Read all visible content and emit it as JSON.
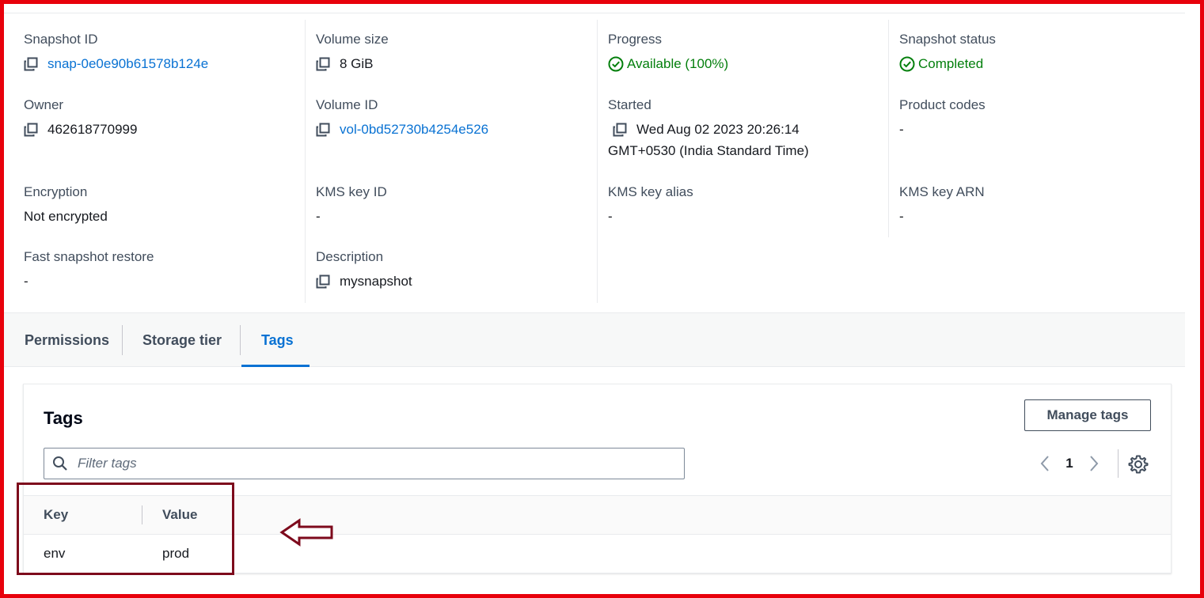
{
  "details": {
    "snapshot_id": {
      "label": "Snapshot ID",
      "value": "snap-0e0e90b61578b124e"
    },
    "volume_size": {
      "label": "Volume size",
      "value": "8 GiB"
    },
    "progress": {
      "label": "Progress",
      "value": "Available (100%)"
    },
    "snapshot_status": {
      "label": "Snapshot status",
      "value": "Completed"
    },
    "owner": {
      "label": "Owner",
      "value": "462618770999"
    },
    "volume_id": {
      "label": "Volume ID",
      "value": "vol-0bd52730b4254e526"
    },
    "started": {
      "label": "Started",
      "value_line1": "Wed Aug 02 2023 20:26:14",
      "value_line2": "GMT+0530 (India Standard Time)"
    },
    "product_codes": {
      "label": "Product codes",
      "value": "-"
    },
    "encryption": {
      "label": "Encryption",
      "value": "Not encrypted"
    },
    "kms_key_id": {
      "label": "KMS key ID",
      "value": "-"
    },
    "kms_key_alias": {
      "label": "KMS key alias",
      "value": "-"
    },
    "kms_key_arn": {
      "label": "KMS key ARN",
      "value": "-"
    },
    "fast_snapshot_restore": {
      "label": "Fast snapshot restore",
      "value": "-"
    },
    "description": {
      "label": "Description",
      "value": "mysnapshot"
    }
  },
  "tabs": [
    {
      "label": "Permissions",
      "active": false
    },
    {
      "label": "Storage tier",
      "active": false
    },
    {
      "label": "Tags",
      "active": true
    }
  ],
  "tags_panel": {
    "title": "Tags",
    "manage_button": "Manage tags",
    "filter_placeholder": "Filter tags",
    "page": "1",
    "columns": [
      "Key",
      "Value"
    ],
    "rows": [
      {
        "key": "env",
        "value": "prod"
      }
    ]
  },
  "colors": {
    "link": "#0972d3",
    "success": "#037f0c",
    "annotation": "#7d0a1c",
    "frame": "#e8000b"
  }
}
